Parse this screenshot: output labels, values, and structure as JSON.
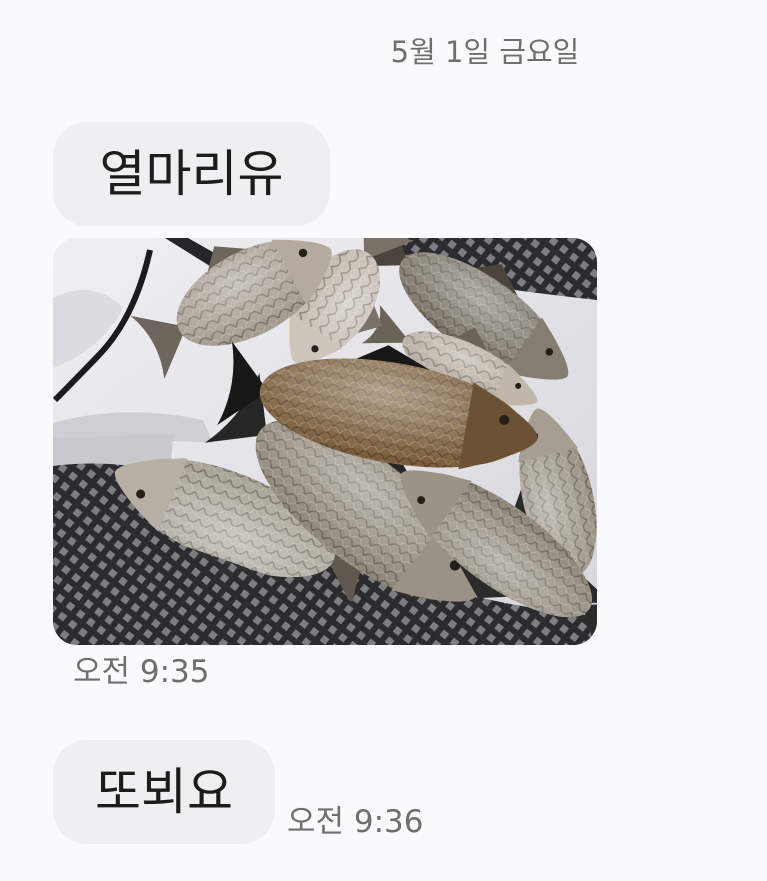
{
  "date_header": "5월 1일 금요일",
  "messages": [
    {
      "text": "열마리유",
      "time": "오전 9:35"
    },
    {
      "text": "또뵈요",
      "time": "오전 9:36"
    }
  ],
  "colors": {
    "background": "#fafafc",
    "bubble": "#efeff1",
    "text": "#1c1c1c",
    "meta_text": "#6f6f6f"
  }
}
